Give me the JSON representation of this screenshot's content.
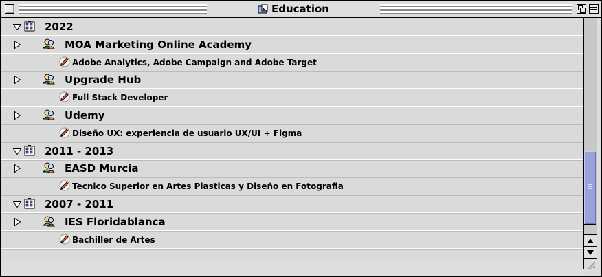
{
  "window": {
    "title": "Education",
    "icon": "folder-doc-icon"
  },
  "rows": [
    {
      "level": 0,
      "label": "2022",
      "expanded": true,
      "icon": "building-icon"
    },
    {
      "level": 1,
      "label": "MOA Marketing Online Academy",
      "expanded": false,
      "icon": "people-icon"
    },
    {
      "level": 2,
      "label": "Adobe Analytics, Adobe Campaign and Adobe Target",
      "icon": "certificate-icon"
    },
    {
      "level": 1,
      "label": "Upgrade Hub",
      "expanded": false,
      "icon": "people-icon"
    },
    {
      "level": 2,
      "label": "Full Stack Developer",
      "icon": "certificate-icon"
    },
    {
      "level": 1,
      "label": "Udemy",
      "expanded": false,
      "icon": "people-icon"
    },
    {
      "level": 2,
      "label": "Diseño UX: experiencia de usuario UX/UI + Figma",
      "icon": "certificate-icon"
    },
    {
      "level": 0,
      "label": "2011 - 2013",
      "expanded": true,
      "icon": "building-icon"
    },
    {
      "level": 1,
      "label": "EASD Murcia",
      "expanded": false,
      "icon": "people-icon"
    },
    {
      "level": 2,
      "label": "Tecnico Superior en Artes Plasticas y Diseño en Fotografia",
      "icon": "certificate-icon"
    },
    {
      "level": 0,
      "label": "2007 - 2011",
      "expanded": true,
      "icon": "building-icon"
    },
    {
      "level": 1,
      "label": "IES Floridablanca",
      "expanded": false,
      "icon": "people-icon"
    },
    {
      "level": 2,
      "label": "Bachiller de Artes",
      "icon": "certificate-icon"
    }
  ],
  "colors": {
    "window_bg": "#dcdcdc",
    "scroll_thumb": "#9aa0d8"
  }
}
